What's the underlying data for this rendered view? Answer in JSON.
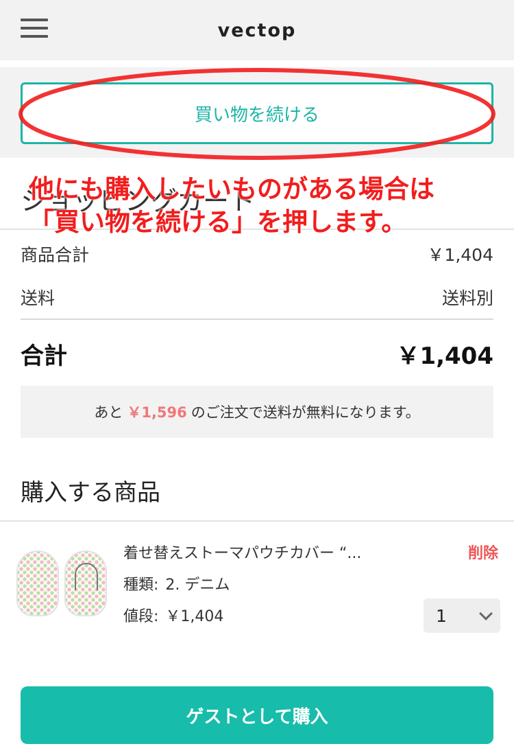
{
  "header": {
    "brand": "vectop",
    "menu_icon": "hamburger-menu-icon"
  },
  "continue_button": {
    "label": "買い物を続ける"
  },
  "cart": {
    "title": "ショッピングカート"
  },
  "summary": {
    "subtotal_label": "商品合計",
    "subtotal_value": "￥1,404",
    "shipping_label": "送料",
    "shipping_value": "送料別",
    "total_label": "合計",
    "total_value": "￥1,404"
  },
  "free_shipping_notice": {
    "prefix": "あと",
    "amount": "￥1,596",
    "suffix": "のご注文で送料が無料になります。"
  },
  "purchase_section": {
    "title": "購入する商品"
  },
  "items": [
    {
      "name": "着せ替えストーマパウチカバー “...",
      "type_label": "種類:",
      "type_value": "2. デニム",
      "price_label": "値段:",
      "price_value": "￥1,404",
      "delete_label": "削除",
      "quantity": "1"
    }
  ],
  "checkout": {
    "guest_label": "ゲストとして購入"
  },
  "annotation": {
    "line1": "他にも購入したいものがある場合は",
    "line2": "「買い物を続ける」を押します。",
    "color": "#f21d1d"
  },
  "colors": {
    "accent": "#17bcab",
    "delete": "#ef5656",
    "free_amount": "#ef7878"
  }
}
